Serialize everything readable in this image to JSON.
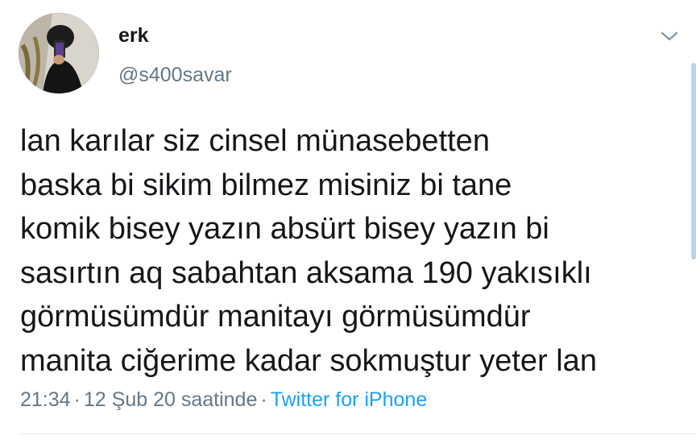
{
  "user": {
    "display_name": "erk",
    "handle": "@s400savar"
  },
  "tweet": {
    "text": "lan karılar siz cinsel münasebetten\nbaska bi sikim bilmez misiniz bi tane\nkomik bisey yazın absürt bisey yazın bi\nsasırtın aq sabahtan aksama 190 yakısıklı\ngörmüsümdür manitayı görmüsümdür\nmanita ciğerime kadar sokmuştur yeter lan",
    "time": "21:34",
    "date": "12 Şub 20 saatinde",
    "source": "Twitter for iPhone"
  },
  "icons": {
    "avatar": "profile-photo",
    "menu": "chevron-down-icon"
  },
  "colors": {
    "text": "#14171a",
    "secondary": "#657786",
    "link": "#1da1f2",
    "divider": "#e1e8ed"
  }
}
